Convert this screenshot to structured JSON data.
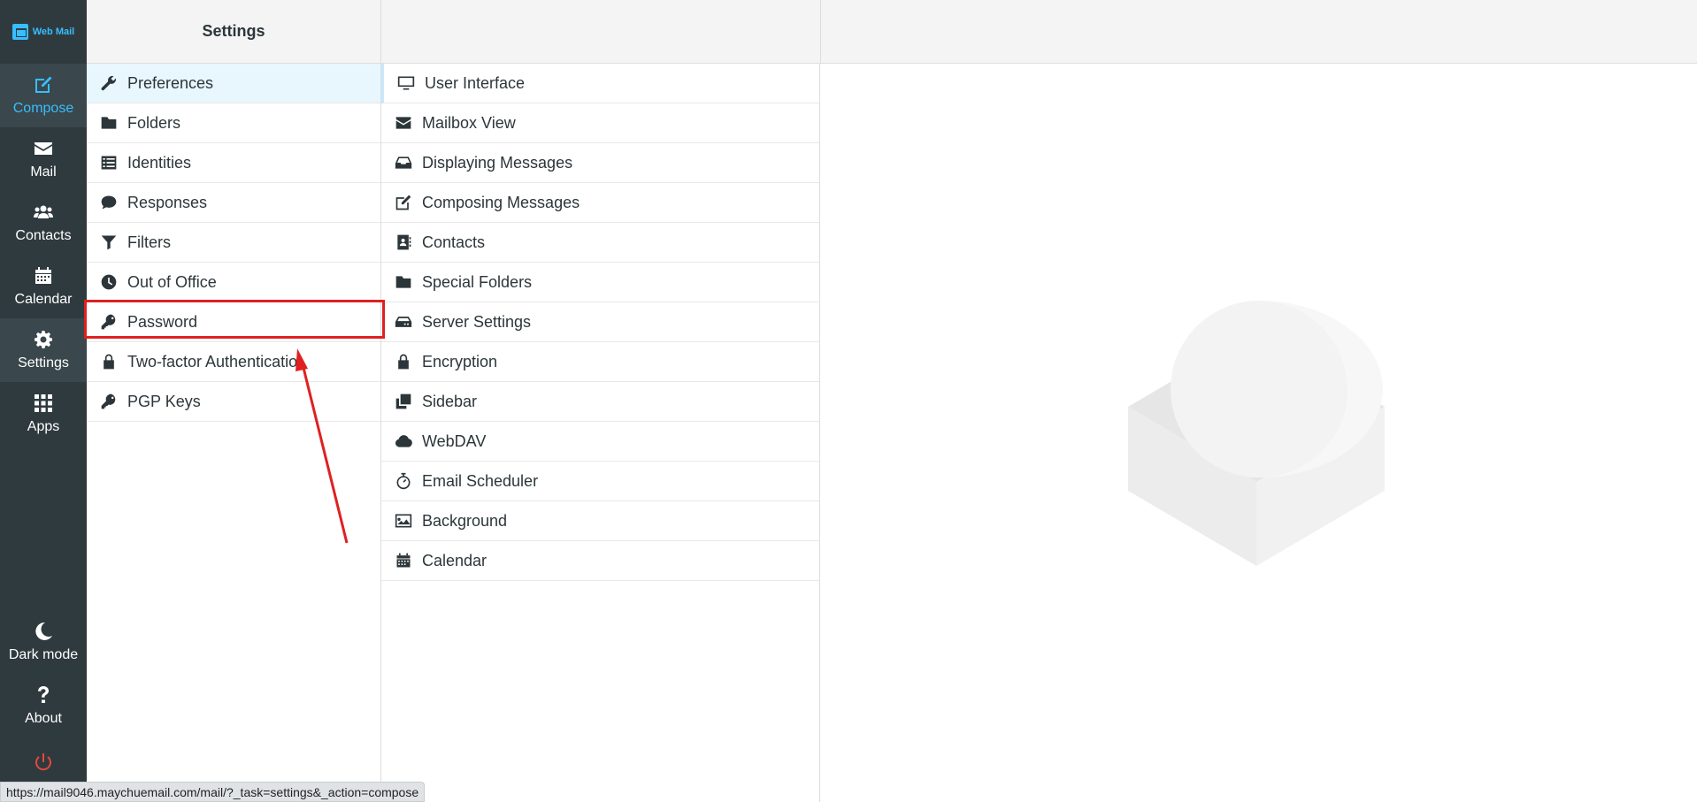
{
  "app": {
    "logo_text": "Web Mail"
  },
  "nav": {
    "items": [
      {
        "label": "Compose",
        "icon": "compose-icon"
      },
      {
        "label": "Mail",
        "icon": "mail-icon"
      },
      {
        "label": "Contacts",
        "icon": "contacts-icon"
      },
      {
        "label": "Calendar",
        "icon": "calendar-icon"
      },
      {
        "label": "Settings",
        "icon": "gear-icon"
      },
      {
        "label": "Apps",
        "icon": "apps-icon"
      }
    ],
    "bottom": [
      {
        "label": "Dark mode",
        "icon": "moon-icon"
      },
      {
        "label": "About",
        "icon": "question-icon"
      }
    ],
    "logout_icon": "power-icon"
  },
  "settings": {
    "title": "Settings",
    "sections": [
      {
        "label": "Preferences",
        "icon": "wrench-icon"
      },
      {
        "label": "Folders",
        "icon": "folder-icon"
      },
      {
        "label": "Identities",
        "icon": "list-icon"
      },
      {
        "label": "Responses",
        "icon": "comment-icon"
      },
      {
        "label": "Filters",
        "icon": "filter-icon"
      },
      {
        "label": "Out of Office",
        "icon": "clock-icon"
      },
      {
        "label": "Password",
        "icon": "key-icon"
      },
      {
        "label": "Two-factor Authenticatio",
        "icon": "lock-icon"
      },
      {
        "label": "PGP Keys",
        "icon": "key-icon"
      }
    ],
    "preferences": [
      {
        "label": "User Interface",
        "icon": "monitor-icon"
      },
      {
        "label": "Mailbox View",
        "icon": "envelope-icon"
      },
      {
        "label": "Displaying Messages",
        "icon": "inbox-icon"
      },
      {
        "label": "Composing Messages",
        "icon": "edit-icon"
      },
      {
        "label": "Contacts",
        "icon": "address-book-icon"
      },
      {
        "label": "Special Folders",
        "icon": "folder-icon"
      },
      {
        "label": "Server Settings",
        "icon": "server-icon"
      },
      {
        "label": "Encryption",
        "icon": "lock-icon"
      },
      {
        "label": "Sidebar",
        "icon": "clone-icon"
      },
      {
        "label": "WebDAV",
        "icon": "cloud-icon"
      },
      {
        "label": "Email Scheduler",
        "icon": "stopwatch-icon"
      },
      {
        "label": "Background",
        "icon": "image-icon"
      },
      {
        "label": "Calendar",
        "icon": "calendar-icon"
      }
    ]
  },
  "statusbar": {
    "url": "https://mail9046.maychuemail.com/mail/?_task=settings&_action=compose"
  },
  "colors": {
    "accent": "#37beff",
    "nav_bg": "#2f3a3f",
    "highlight": "#e02020",
    "logout": "#e2483d"
  }
}
